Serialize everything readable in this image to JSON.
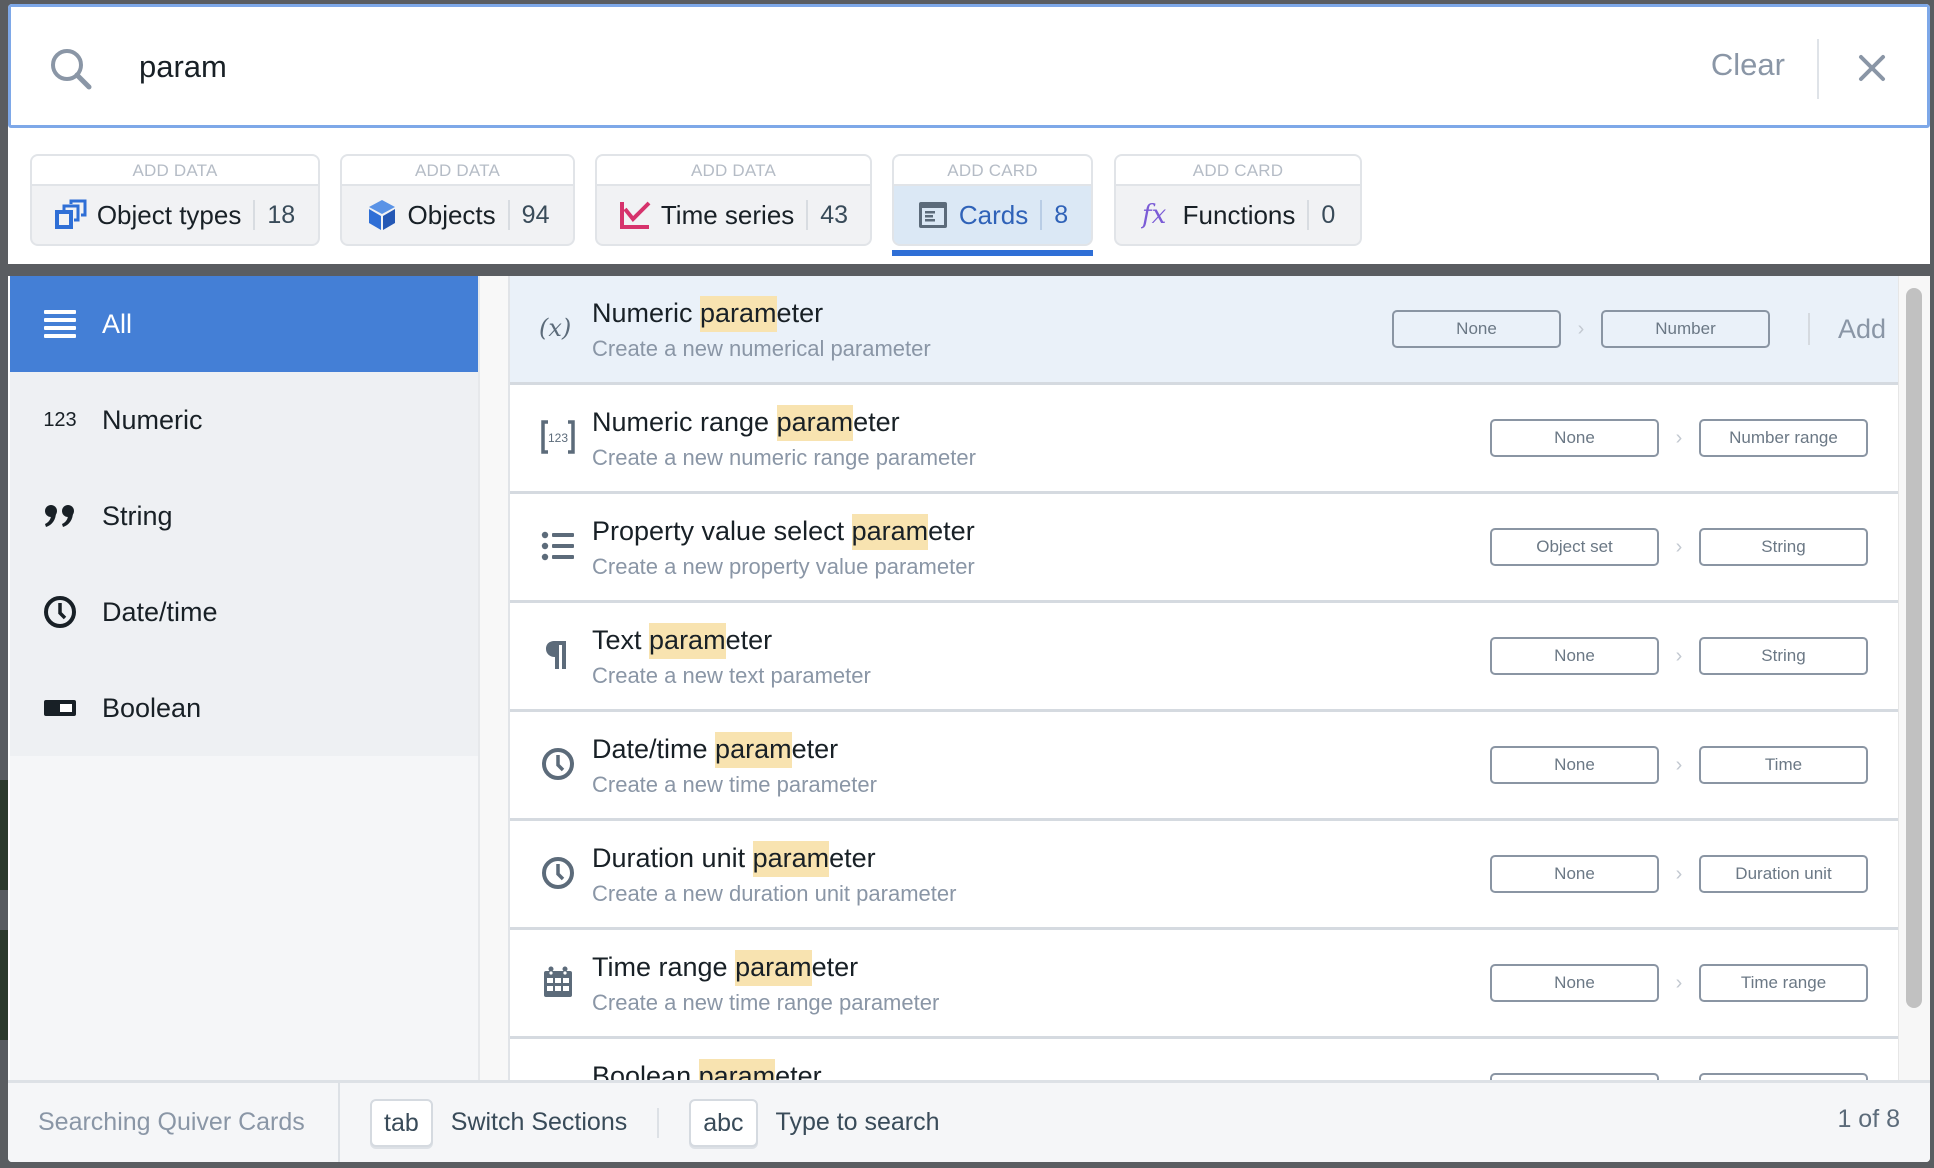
{
  "search": {
    "query": "param",
    "clear_label": "Clear",
    "accent_color": "#7ea8e8"
  },
  "tabs": [
    {
      "section": "ADD DATA",
      "label": "Object types",
      "count": "18",
      "icon": "object-types-icon",
      "icon_color": "#2f6fd6",
      "active": false
    },
    {
      "section": "ADD DATA",
      "label": "Objects",
      "count": "94",
      "icon": "cube-icon",
      "icon_color": "#2f6fd6",
      "active": false
    },
    {
      "section": "ADD DATA",
      "label": "Time series",
      "count": "43",
      "icon": "line-chart-icon",
      "icon_color": "#d6336c",
      "active": false
    },
    {
      "section": "ADD CARD",
      "label": "Cards",
      "count": "8",
      "icon": "card-icon",
      "icon_color": "#5c6b7a",
      "active": true
    },
    {
      "section": "ADD CARD",
      "label": "Functions",
      "count": "0",
      "icon": "function-icon",
      "icon_color": "#7b5cd6",
      "active": false
    }
  ],
  "sidebar": {
    "items": [
      {
        "label": "All",
        "icon": "list-icon",
        "active": true
      },
      {
        "label": "Numeric",
        "icon": "numeric-icon",
        "icon_text": "123",
        "active": false
      },
      {
        "label": "String",
        "icon": "quote-icon",
        "active": false
      },
      {
        "label": "Date/time",
        "icon": "clock-icon",
        "active": false
      },
      {
        "label": "Boolean",
        "icon": "toggle-icon",
        "active": false
      }
    ],
    "active_color": "#447fd6"
  },
  "results": {
    "highlight": "param",
    "add_label": "Add",
    "items": [
      {
        "title_pre": "Numeric ",
        "title_match": "param",
        "title_post": "eter",
        "description": "Create a new numerical parameter",
        "icon": "variable-icon",
        "from": "None",
        "to": "Number",
        "selected": true
      },
      {
        "title_pre": "Numeric range ",
        "title_match": "param",
        "title_post": "eter",
        "description": "Create a new numeric range parameter",
        "icon": "numeric-range-icon",
        "from": "None",
        "to": "Number range",
        "selected": false
      },
      {
        "title_pre": "Property value select ",
        "title_match": "param",
        "title_post": "eter",
        "description": "Create a new property value parameter",
        "icon": "property-list-icon",
        "from": "Object set",
        "to": "String",
        "selected": false
      },
      {
        "title_pre": "Text ",
        "title_match": "param",
        "title_post": "eter",
        "description": "Create a new text parameter",
        "icon": "paragraph-icon",
        "from": "None",
        "to": "String",
        "selected": false
      },
      {
        "title_pre": "Date/time ",
        "title_match": "param",
        "title_post": "eter",
        "description": "Create a new time parameter",
        "icon": "clock-icon",
        "from": "None",
        "to": "Time",
        "selected": false
      },
      {
        "title_pre": "Duration unit ",
        "title_match": "param",
        "title_post": "eter",
        "description": "Create a new duration unit parameter",
        "icon": "clock-icon",
        "from": "None",
        "to": "Duration unit",
        "selected": false
      },
      {
        "title_pre": "Time range ",
        "title_match": "param",
        "title_post": "eter",
        "description": "Create a new time range parameter",
        "icon": "calendar-icon",
        "from": "None",
        "to": "Time range",
        "selected": false
      },
      {
        "title_pre": "Boolean ",
        "title_match": "param",
        "title_post": "eter",
        "description": "",
        "icon": "toggle-icon",
        "from": "",
        "to": "",
        "selected": false
      }
    ]
  },
  "footer": {
    "status": "Searching Quiver Cards",
    "hints": [
      {
        "key": "tab",
        "label": "Switch Sections"
      },
      {
        "key": "abc",
        "label": "Type to search"
      }
    ],
    "pager": "1 of 8"
  }
}
